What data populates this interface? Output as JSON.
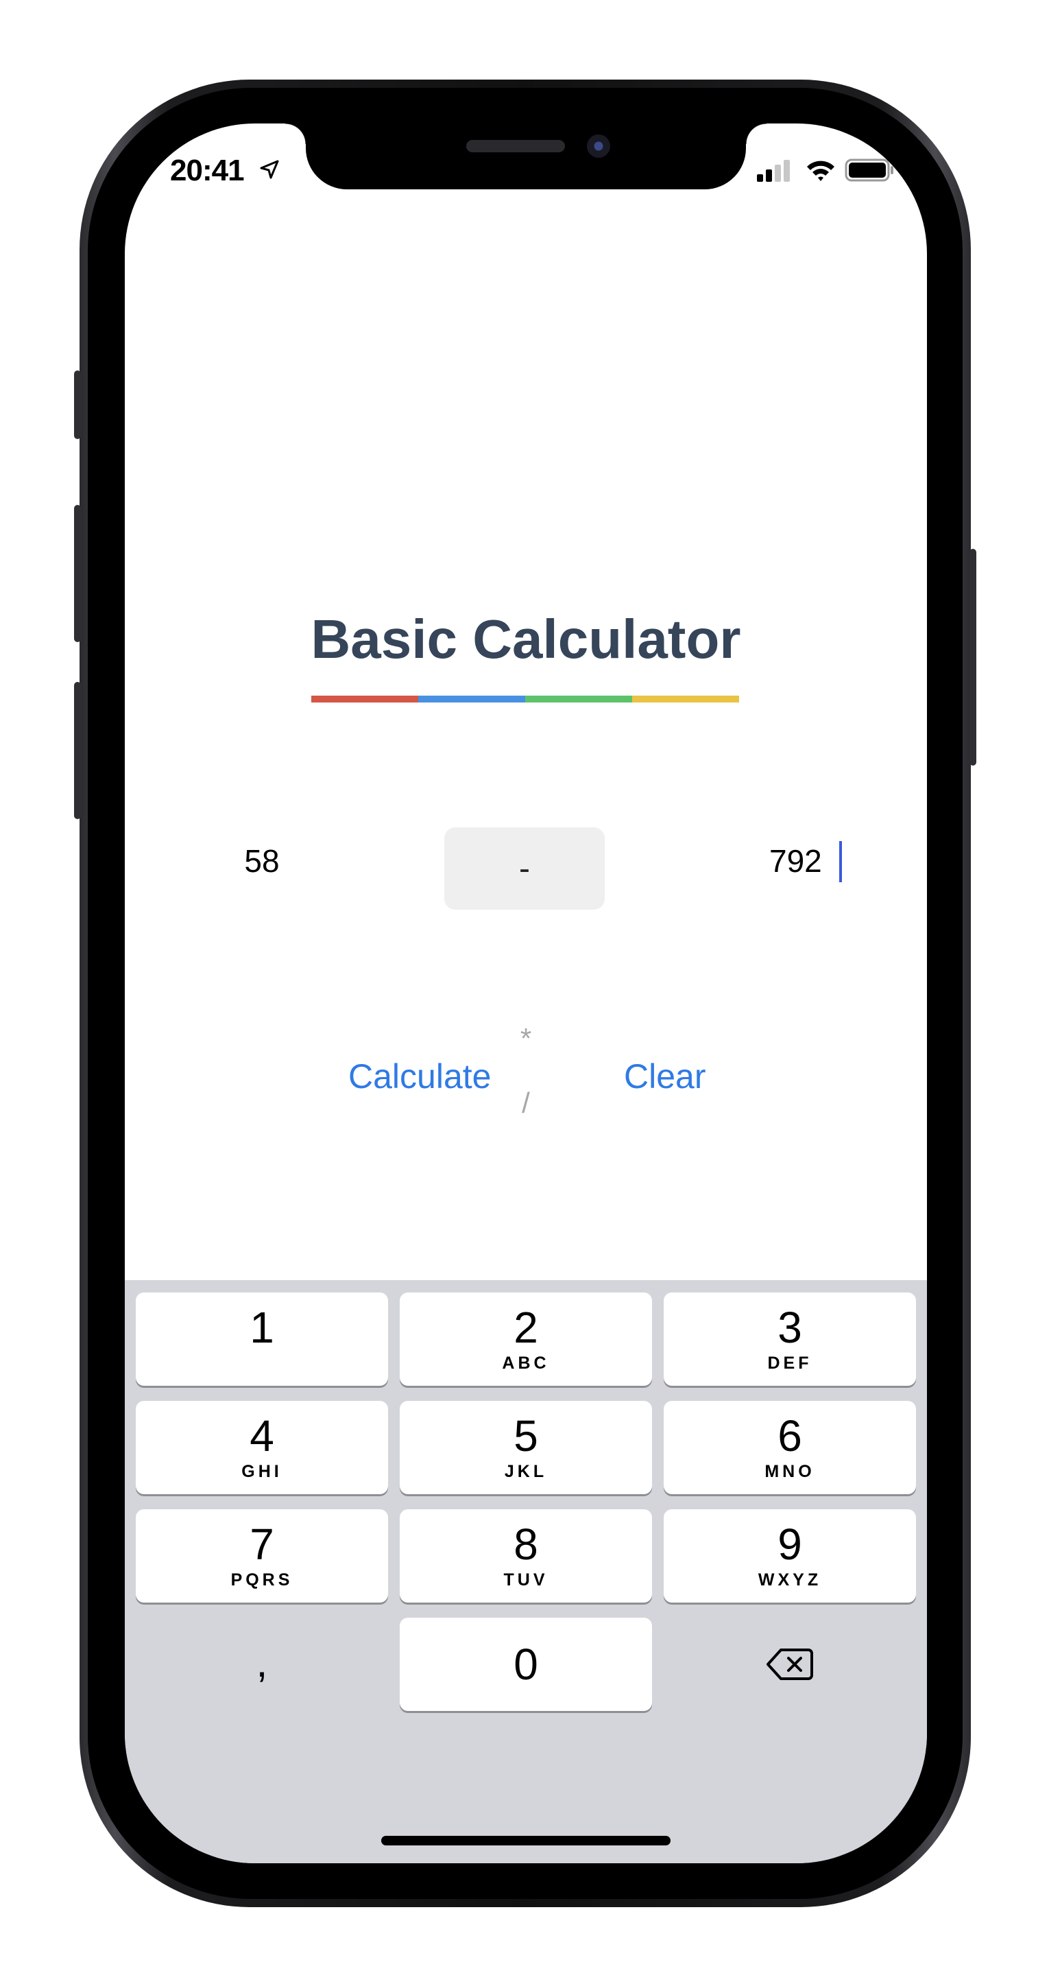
{
  "status_bar": {
    "time": "20:41"
  },
  "app": {
    "title": "Basic Calculator",
    "underline_colors": [
      "#d45645",
      "#4a90e2",
      "#5ec26a",
      "#e9c344"
    ],
    "operand_a": "58",
    "operand_b": "792",
    "operators": {
      "plus": "+",
      "minus": "-",
      "multiply": "*",
      "divide": "/"
    },
    "selected_operator": "-",
    "calculate_label": "Calculate",
    "clear_label": "Clear"
  },
  "keyboard": {
    "keys": [
      {
        "digit": "1",
        "letters": ""
      },
      {
        "digit": "2",
        "letters": "ABC"
      },
      {
        "digit": "3",
        "letters": "DEF"
      },
      {
        "digit": "4",
        "letters": "GHI"
      },
      {
        "digit": "5",
        "letters": "JKL"
      },
      {
        "digit": "6",
        "letters": "MNO"
      },
      {
        "digit": "7",
        "letters": "PQRS"
      },
      {
        "digit": "8",
        "letters": "TUV"
      },
      {
        "digit": "9",
        "letters": "WXYZ"
      }
    ],
    "comma": ",",
    "zero": "0",
    "backspace_icon": "delete-left-icon"
  },
  "colors": {
    "title": "#364559",
    "link": "#2f7ae5",
    "keyboard_bg": "#d3d5da"
  }
}
